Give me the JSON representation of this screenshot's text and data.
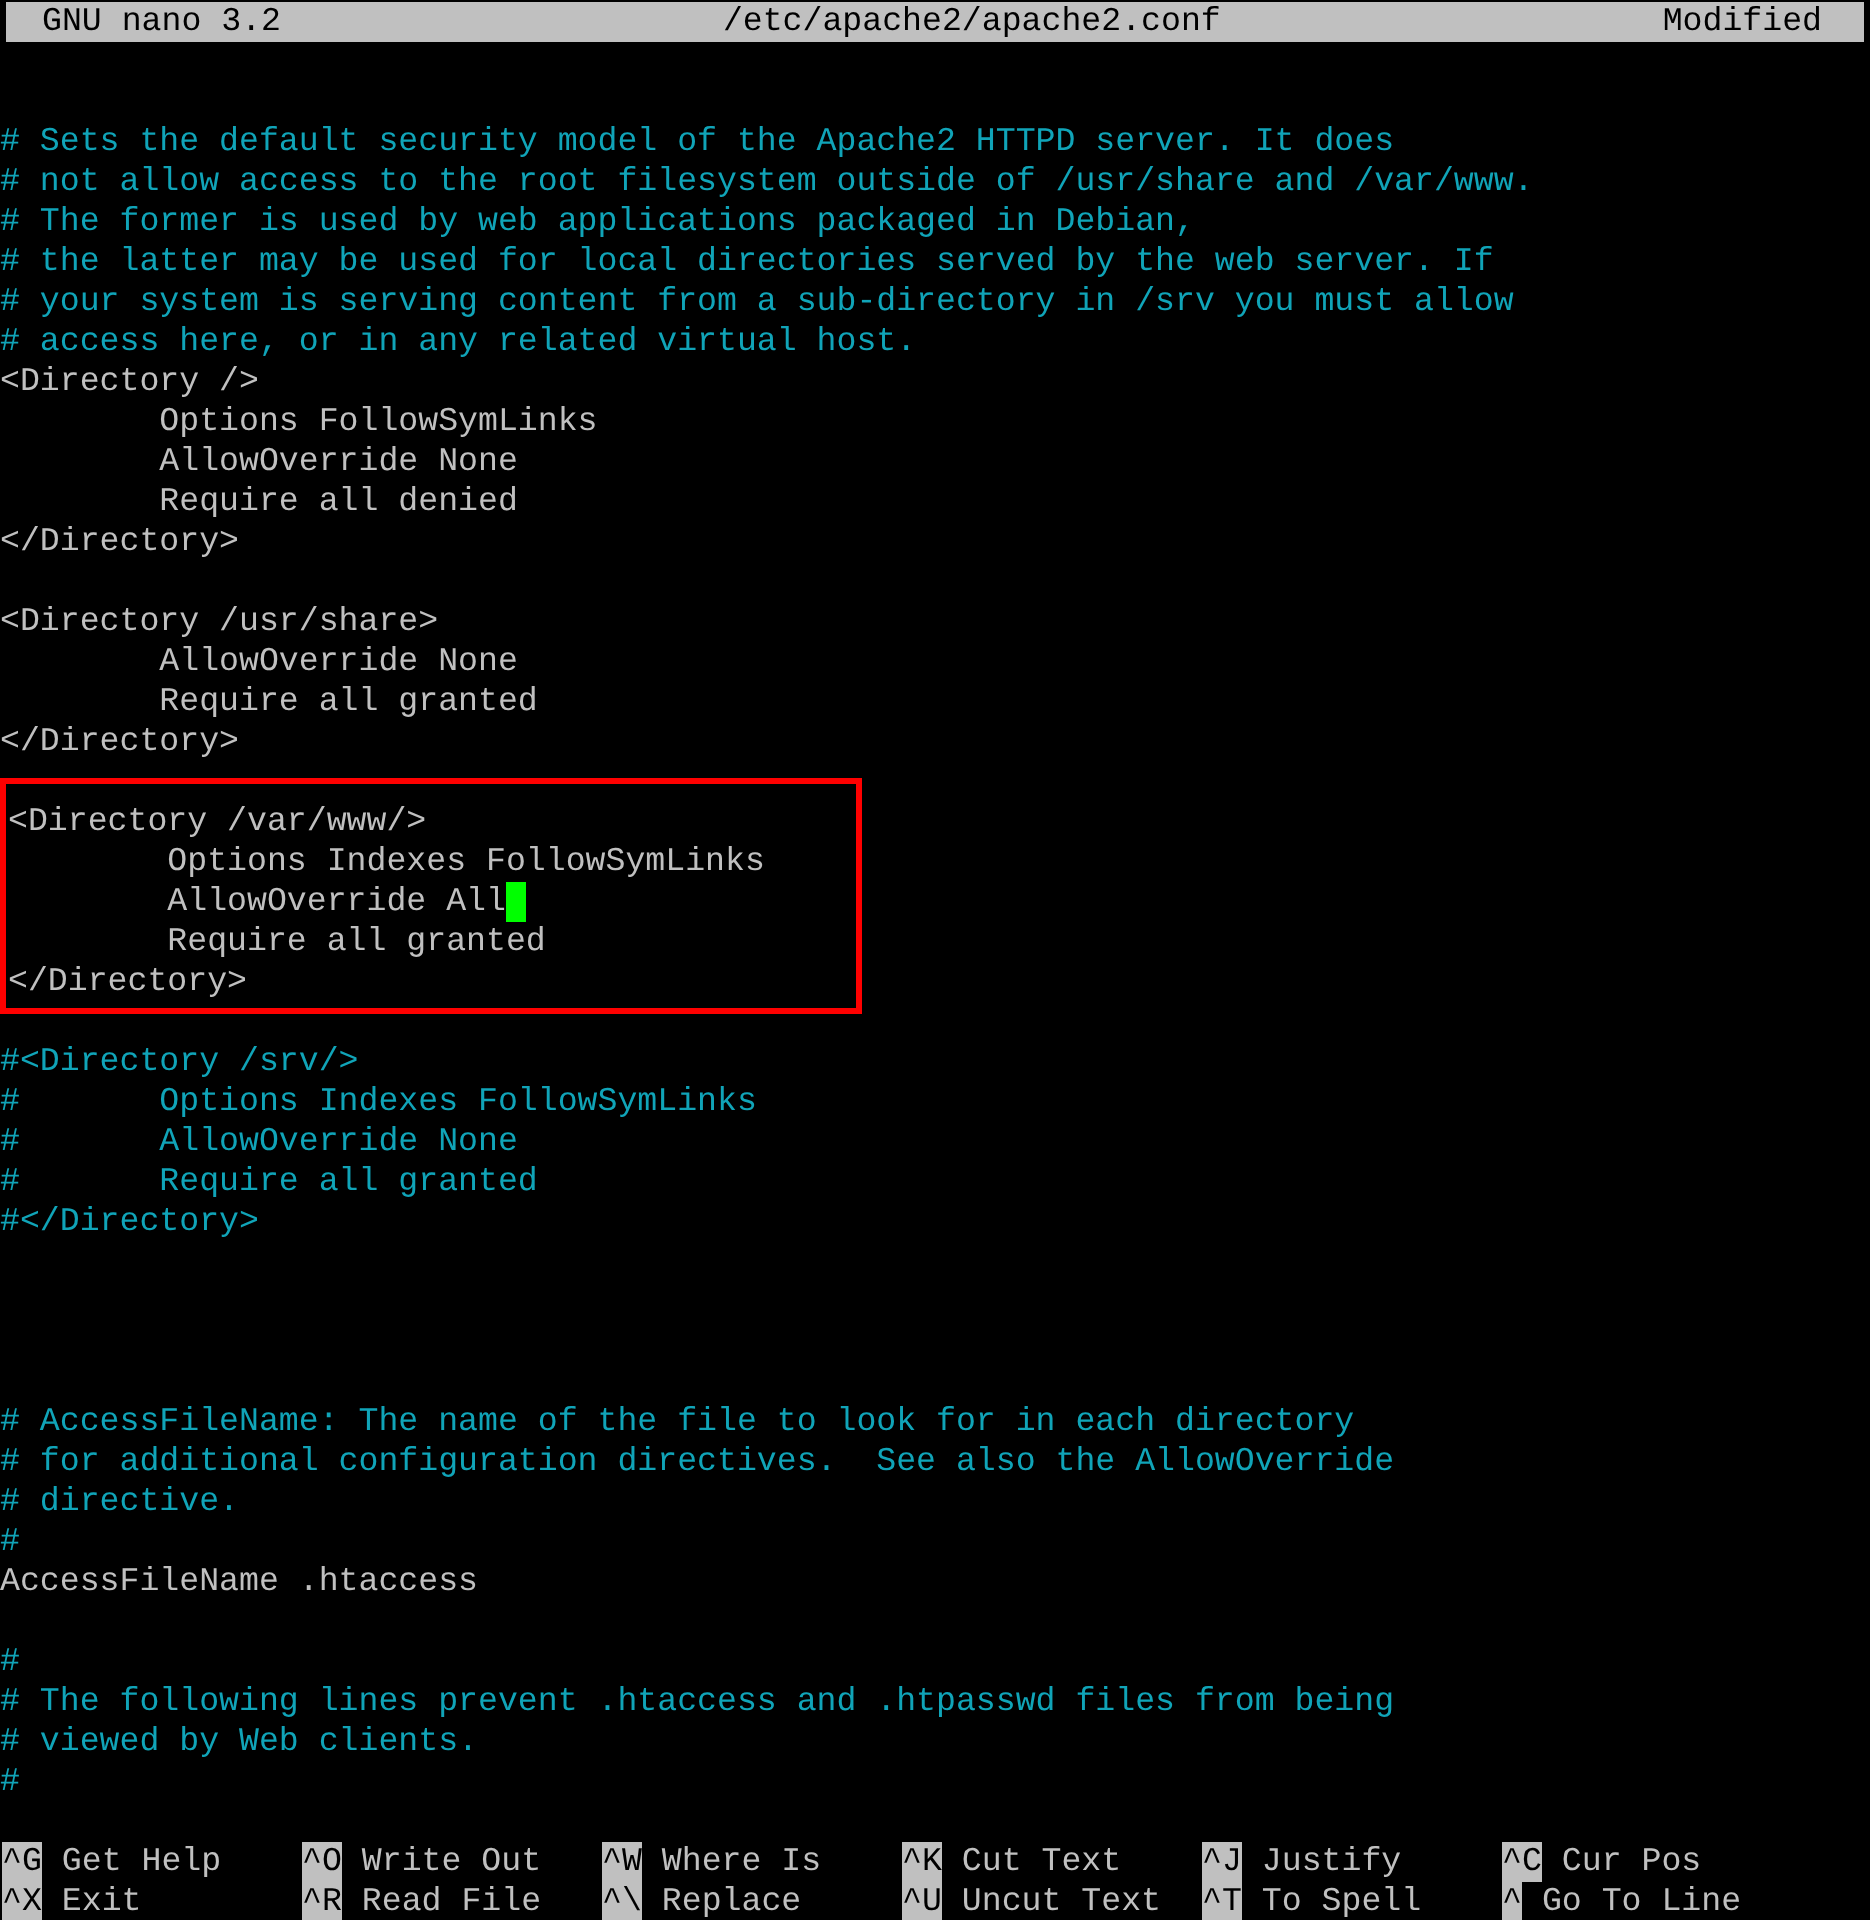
{
  "title_bar": {
    "app": "GNU nano 3.2",
    "file": "/etc/apache2/apache2.conf",
    "status": "Modified"
  },
  "blocks": [
    {
      "kind": "plain",
      "lines": [
        {
          "kind": "blank"
        },
        {
          "kind": "blank"
        },
        {
          "kind": "comment",
          "text": "# Sets the default security model of the Apache2 HTTPD server. It does",
          "cursor": false
        },
        {
          "kind": "comment",
          "text": "# not allow access to the root filesystem outside of /usr/share and /var/www.",
          "cursor": false
        },
        {
          "kind": "comment",
          "text": "# The former is used by web applications packaged in Debian,",
          "cursor": false
        },
        {
          "kind": "comment",
          "text": "# the latter may be used for local directories served by the web server. If",
          "cursor": false
        },
        {
          "kind": "comment",
          "text": "# your system is serving content from a sub-directory in /srv you must allow",
          "cursor": false
        },
        {
          "kind": "comment",
          "text": "# access here, or in any related virtual host.",
          "cursor": false
        },
        {
          "kind": "code",
          "text": "<Directory />",
          "cursor": false
        },
        {
          "kind": "code",
          "text": "\tOptions FollowSymLinks",
          "cursor": false
        },
        {
          "kind": "code",
          "text": "\tAllowOverride None",
          "cursor": false
        },
        {
          "kind": "code",
          "text": "\tRequire all denied",
          "cursor": false
        },
        {
          "kind": "code",
          "text": "</Directory>",
          "cursor": false
        },
        {
          "kind": "blank"
        },
        {
          "kind": "code",
          "text": "<Directory /usr/share>",
          "cursor": false
        },
        {
          "kind": "code",
          "text": "\tAllowOverride None",
          "cursor": false
        },
        {
          "kind": "code",
          "text": "\tRequire all granted",
          "cursor": false
        },
        {
          "kind": "code",
          "text": "</Directory>",
          "cursor": false
        },
        {
          "kind": "blank"
        }
      ]
    },
    {
      "kind": "highlight",
      "lines": [
        {
          "kind": "code",
          "text": "<Directory /var/www/>",
          "cursor": false
        },
        {
          "kind": "code",
          "text": "\tOptions Indexes FollowSymLinks",
          "cursor": false
        },
        {
          "kind": "code",
          "text": "\tAllowOverride All",
          "cursor": true
        },
        {
          "kind": "code",
          "text": "\tRequire all granted",
          "cursor": false
        },
        {
          "kind": "code",
          "text": "</Directory>",
          "cursor": false
        }
      ]
    },
    {
      "kind": "plain",
      "lines": [
        {
          "kind": "blank"
        },
        {
          "kind": "comment",
          "text": "#<Directory /srv/>",
          "cursor": false
        },
        {
          "kind": "comment",
          "text": "#\tOptions Indexes FollowSymLinks",
          "cursor": false
        },
        {
          "kind": "comment",
          "text": "#\tAllowOverride None",
          "cursor": false
        },
        {
          "kind": "comment",
          "text": "#\tRequire all granted",
          "cursor": false
        },
        {
          "kind": "comment",
          "text": "#</Directory>",
          "cursor": false
        },
        {
          "kind": "blank"
        },
        {
          "kind": "blank"
        },
        {
          "kind": "blank"
        },
        {
          "kind": "blank"
        },
        {
          "kind": "comment",
          "text": "# AccessFileName: The name of the file to look for in each directory",
          "cursor": false
        },
        {
          "kind": "comment",
          "text": "# for additional configuration directives.  See also the AllowOverride",
          "cursor": false
        },
        {
          "kind": "comment",
          "text": "# directive.",
          "cursor": false
        },
        {
          "kind": "comment",
          "text": "#",
          "cursor": false
        },
        {
          "kind": "code",
          "text": "AccessFileName .htaccess",
          "cursor": false
        },
        {
          "kind": "blank"
        },
        {
          "kind": "comment",
          "text": "#",
          "cursor": false
        },
        {
          "kind": "comment",
          "text": "# The following lines prevent .htaccess and .htpasswd files from being",
          "cursor": false
        },
        {
          "kind": "comment",
          "text": "# viewed by Web clients.",
          "cursor": false
        },
        {
          "kind": "comment",
          "text": "#",
          "cursor": false
        }
      ]
    }
  ],
  "shortcuts": [
    {
      "key": "^G",
      "label": "Get Help"
    },
    {
      "key": "^O",
      "label": "Write Out"
    },
    {
      "key": "^W",
      "label": "Where Is"
    },
    {
      "key": "^K",
      "label": "Cut Text"
    },
    {
      "key": "^J",
      "label": "Justify"
    },
    {
      "key": "^C",
      "label": "Cur Pos"
    },
    {
      "key": "^X",
      "label": "Exit"
    },
    {
      "key": "^R",
      "label": "Read File"
    },
    {
      "key": "^\\",
      "label": "Replace"
    },
    {
      "key": "^U",
      "label": "Uncut Text"
    },
    {
      "key": "^T",
      "label": "To Spell"
    },
    {
      "key": "^",
      "label": "Go To Line"
    }
  ]
}
